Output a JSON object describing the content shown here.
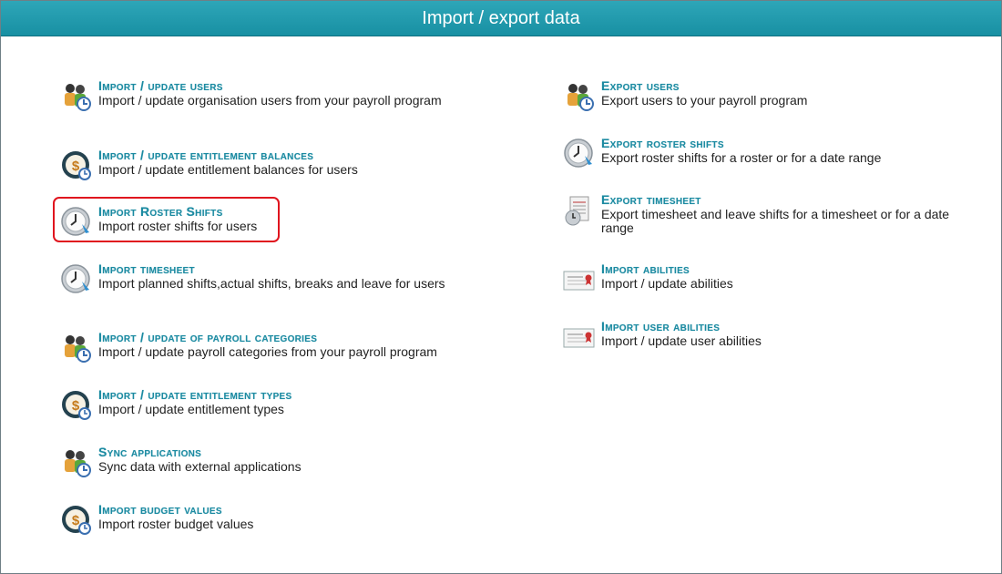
{
  "header": {
    "title": "Import / export data"
  },
  "left": [
    {
      "title": "Import / update users",
      "desc": "Import / update organisation users from your payroll program",
      "icon": "users-icon"
    },
    {
      "title": "Import / update entitlement balances",
      "desc": "Import / update entitlement balances for users",
      "icon": "entitlement-icon"
    },
    {
      "title": "Import Roster Shifts",
      "desc": "Import roster shifts for users",
      "icon": "clock-icon"
    },
    {
      "title": "Import timesheet",
      "desc": "Import planned shifts,actual shifts, breaks and leave for users",
      "icon": "clock-icon"
    },
    {
      "title": "Import / update of payroll categories",
      "desc": "Import / update payroll categories from your payroll program",
      "icon": "users-icon"
    },
    {
      "title": "Import / update entitlement types",
      "desc": "Import / update entitlement types",
      "icon": "entitlement-icon"
    },
    {
      "title": "Sync applications",
      "desc": "Sync data with external applications",
      "icon": "users-icon"
    },
    {
      "title": "Import budget values",
      "desc": "Import roster budget values",
      "icon": "entitlement-icon"
    }
  ],
  "right": [
    {
      "title": "Export users",
      "desc": "Export users to your payroll program",
      "icon": "users-icon"
    },
    {
      "title": "Export roster shifts",
      "desc": "Export roster shifts for a roster or for a date range",
      "icon": "clock-icon"
    },
    {
      "title": "Export timesheet",
      "desc": "Export timesheet and leave shifts for a timesheet or for a date range",
      "icon": "timesheet-icon"
    },
    {
      "title": "Import abilities",
      "desc": "Import / update abilities",
      "icon": "certificate-icon"
    },
    {
      "title": "Import user abilities",
      "desc": "Import / update user abilities",
      "icon": "certificate-icon"
    }
  ]
}
